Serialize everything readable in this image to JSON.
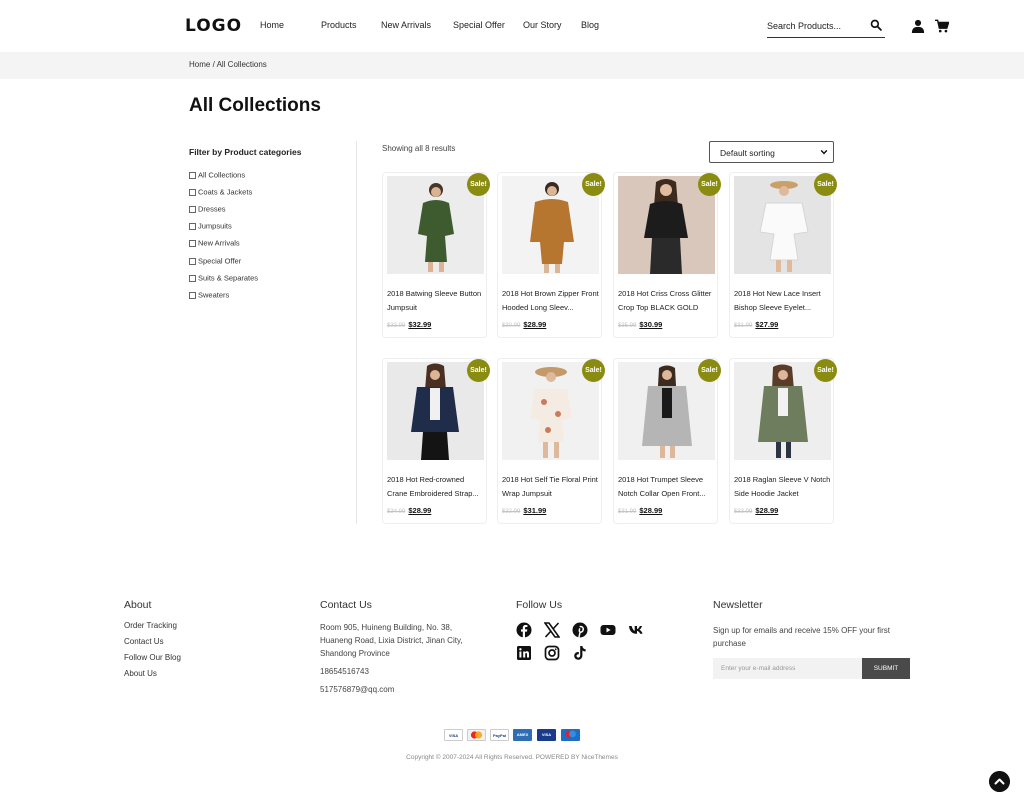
{
  "header": {
    "logo": "LOGO",
    "nav": [
      {
        "label": "Home"
      },
      {
        "label": "Products"
      },
      {
        "label": "New Arrivals"
      },
      {
        "label": "Special Offer"
      },
      {
        "label": "Our Story"
      },
      {
        "label": "Blog"
      }
    ],
    "search_placeholder": "Search Products...",
    "icons": [
      "search-icon",
      "user-icon",
      "cart-icon"
    ]
  },
  "breadcrumb": "Home / All Collections",
  "page_title": "All Collections",
  "sidebar": {
    "title": "Filter by Product categories",
    "items": [
      {
        "label": "All Collections"
      },
      {
        "label": "Coats & Jackets"
      },
      {
        "label": "Dresses"
      },
      {
        "label": "Jumpsuits"
      },
      {
        "label": "New Arrivals"
      },
      {
        "label": "Special Offer"
      },
      {
        "label": "Suits & Separates"
      },
      {
        "label": "Sweaters"
      }
    ]
  },
  "results": {
    "count_text": "Showing all 8 results",
    "sort": {
      "selected": "Default sorting"
    },
    "sale_badge": "Sale!",
    "products": [
      {
        "name": "2018 Batwing Sleeve Button Jumpsuit",
        "old_price": "$33.99",
        "price": "$32.99"
      },
      {
        "name": "2018 Hot Brown Zipper Front Hooded Long Sleev...",
        "old_price": "$30.99",
        "price": "$28.99"
      },
      {
        "name": "2018 Hot Criss Cross Glitter Crop Top BLACK GOLD",
        "old_price": "$35.99",
        "price": "$30.99"
      },
      {
        "name": "2018 Hot New Lace Insert Bishop Sleeve Eyelet...",
        "old_price": "$31.99",
        "price": "$27.99"
      },
      {
        "name": "2018 Hot Red-crowned Crane Embroidered Strap...",
        "old_price": "$34.99",
        "price": "$28.99"
      },
      {
        "name": "2018 Hot Self Tie Floral Print Wrap Jumpsuit",
        "old_price": "$32.99",
        "price": "$31.99"
      },
      {
        "name": "2018 Hot Trumpet Sleeve Notch Collar Open Front...",
        "old_price": "$31.99",
        "price": "$28.99"
      },
      {
        "name": "2018 Raglan Sleeve V Notch Side Hoodie Jacket",
        "old_price": "$33.99",
        "price": "$28.99"
      }
    ]
  },
  "footer": {
    "about": {
      "title": "About",
      "links": [
        "Order Tracking",
        "Contact Us",
        "Follow Our Blog",
        "About Us"
      ]
    },
    "contact": {
      "title": "Contact Us",
      "address": "Room 905, Huineng Building, No. 38, Huaneng Road, Lixia District, Jinan City, Shandong Province",
      "phone": "18654516743",
      "email": "517576879@qq.com"
    },
    "follow": {
      "title": "Follow Us",
      "icons": [
        "facebook-icon",
        "x-icon",
        "pinterest-icon",
        "youtube-icon",
        "vk-icon",
        "linkedin-icon",
        "instagram-icon",
        "tiktok-icon"
      ]
    },
    "newsletter": {
      "title": "Newsletter",
      "text": "Sign up for emails and receive 15% OFF your first purchase",
      "placeholder": "Enter your e-mail address",
      "button": "SUBMIT"
    },
    "payments": [
      "visa-icon",
      "mastercard-icon",
      "paypal-icon",
      "amex-icon",
      "visa-electron-icon",
      "maestro-icon"
    ],
    "copyright": "Copyright © 2007-2024 All Rights Reserved. POWERED BY NiceThemes"
  },
  "colors": {
    "sale_badge": "#8a8c12",
    "breadcrumb_bg": "#f4f4f4",
    "submit_bg": "#4a4a4a"
  }
}
